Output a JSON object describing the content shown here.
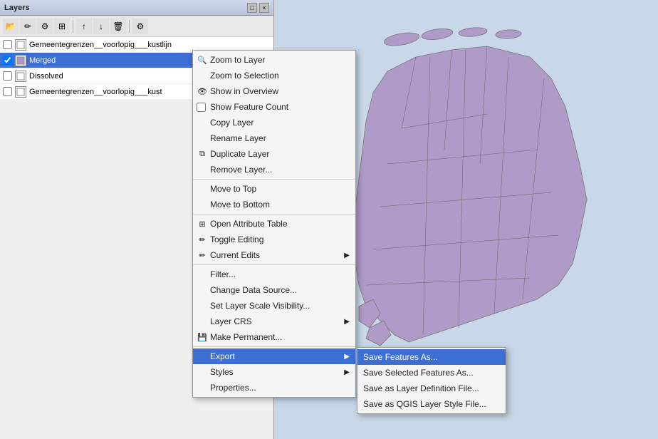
{
  "window": {
    "title": "Layers",
    "titlebar_controls": [
      "□",
      "×"
    ]
  },
  "toolbar": {
    "buttons": [
      "⊞",
      "⊟",
      "↑",
      "↓",
      "⟳",
      "☰",
      "≡",
      "⊕",
      "⊗",
      "◈",
      "◉"
    ]
  },
  "layers": [
    {
      "name": "Gemeentegrenzen__voorlopig___kustlijn",
      "checked": false,
      "has_icon": true,
      "icon_type": "polygon",
      "selected": false
    },
    {
      "name": "Merged",
      "checked": true,
      "has_icon": true,
      "icon_type": "polygon",
      "selected": true
    },
    {
      "name": "Dissolved",
      "checked": false,
      "has_icon": false,
      "icon_type": "polygon",
      "selected": false
    },
    {
      "name": "Gemeentegrenzen__voorlopig___kust",
      "checked": false,
      "has_icon": true,
      "icon_type": "polygon",
      "selected": false
    }
  ],
  "context_menu": {
    "items": [
      {
        "id": "zoom-to-layer",
        "label": "Zoom to Layer",
        "icon": "🔍",
        "has_submenu": false,
        "separator_after": false
      },
      {
        "id": "zoom-to-selection",
        "label": "Zoom to Selection",
        "icon": "",
        "has_submenu": false,
        "separator_after": false
      },
      {
        "id": "show-in-overview",
        "label": "Show in Overview",
        "icon": "👁",
        "has_submenu": false,
        "separator_after": false
      },
      {
        "id": "show-feature-count",
        "label": "Show Feature Count",
        "icon": "",
        "has_checkbox": true,
        "has_submenu": false,
        "separator_after": false
      },
      {
        "id": "copy-layer",
        "label": "Copy Layer",
        "icon": "",
        "has_submenu": false,
        "separator_after": false
      },
      {
        "id": "rename-layer",
        "label": "Rename Layer",
        "icon": "",
        "has_submenu": false,
        "separator_after": false
      },
      {
        "id": "duplicate-layer",
        "label": "Duplicate Layer",
        "icon": "⧉",
        "has_submenu": false,
        "separator_after": false
      },
      {
        "id": "remove-layer",
        "label": "Remove Layer...",
        "icon": "",
        "has_submenu": false,
        "separator_after": true
      },
      {
        "id": "move-to-top",
        "label": "Move to Top",
        "icon": "",
        "has_submenu": false,
        "separator_after": false
      },
      {
        "id": "move-to-bottom",
        "label": "Move to Bottom",
        "icon": "",
        "has_submenu": false,
        "separator_after": true
      },
      {
        "id": "open-attribute-table",
        "label": "Open Attribute Table",
        "icon": "⊞",
        "has_submenu": false,
        "separator_after": false
      },
      {
        "id": "toggle-editing",
        "label": "Toggle Editing",
        "icon": "✏",
        "has_submenu": false,
        "separator_after": false
      },
      {
        "id": "current-edits",
        "label": "Current Edits",
        "icon": "✏",
        "has_submenu": true,
        "separator_after": true
      },
      {
        "id": "filter",
        "label": "Filter...",
        "icon": "",
        "has_submenu": false,
        "separator_after": false
      },
      {
        "id": "change-data-source",
        "label": "Change Data Source...",
        "icon": "",
        "has_submenu": false,
        "separator_after": false
      },
      {
        "id": "set-layer-scale",
        "label": "Set Layer Scale Visibility...",
        "icon": "",
        "has_submenu": false,
        "separator_after": false
      },
      {
        "id": "layer-crs",
        "label": "Layer CRS",
        "icon": "",
        "has_submenu": true,
        "separator_after": false
      },
      {
        "id": "make-permanent",
        "label": "Make Permanent...",
        "icon": "💾",
        "has_submenu": false,
        "separator_after": true
      },
      {
        "id": "export",
        "label": "Export",
        "icon": "",
        "has_submenu": true,
        "highlighted": true,
        "separator_after": false
      },
      {
        "id": "styles",
        "label": "Styles",
        "icon": "",
        "has_submenu": true,
        "separator_after": false
      },
      {
        "id": "properties",
        "label": "Properties...",
        "icon": "",
        "has_submenu": false,
        "separator_after": false
      }
    ]
  },
  "export_submenu": {
    "items": [
      {
        "id": "save-features-as",
        "label": "Save Features As...",
        "highlighted": true
      },
      {
        "id": "save-selected-features-as",
        "label": "Save Selected Features As..."
      },
      {
        "id": "save-as-layer-definition",
        "label": "Save as Layer Definition File..."
      },
      {
        "id": "save-as-qgis-style",
        "label": "Save as QGIS Layer Style File..."
      }
    ]
  },
  "colors": {
    "map_background": "#c8d8e8",
    "netherlands_fill": "#b09ac8",
    "netherlands_stroke": "#888",
    "selected_blue": "#3c6ed4",
    "menu_bg": "#f5f5f5"
  }
}
